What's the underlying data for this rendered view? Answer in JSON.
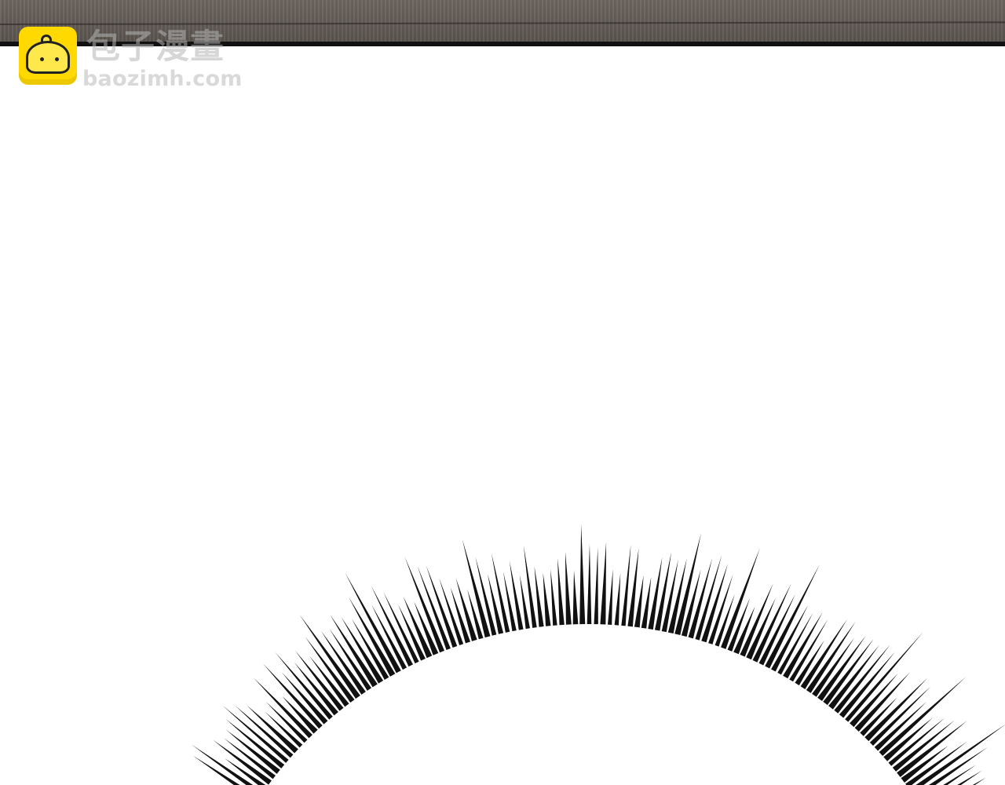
{
  "watermark": {
    "logo_text": "包子漫畫",
    "url_text": "baozimh.com",
    "brand_color": "#ffd900"
  },
  "artwork": {
    "top_panel_color": "#625b56",
    "line_art_color": "#111111",
    "background_color": "#ffffff",
    "effect": "radial-speed-lines"
  }
}
